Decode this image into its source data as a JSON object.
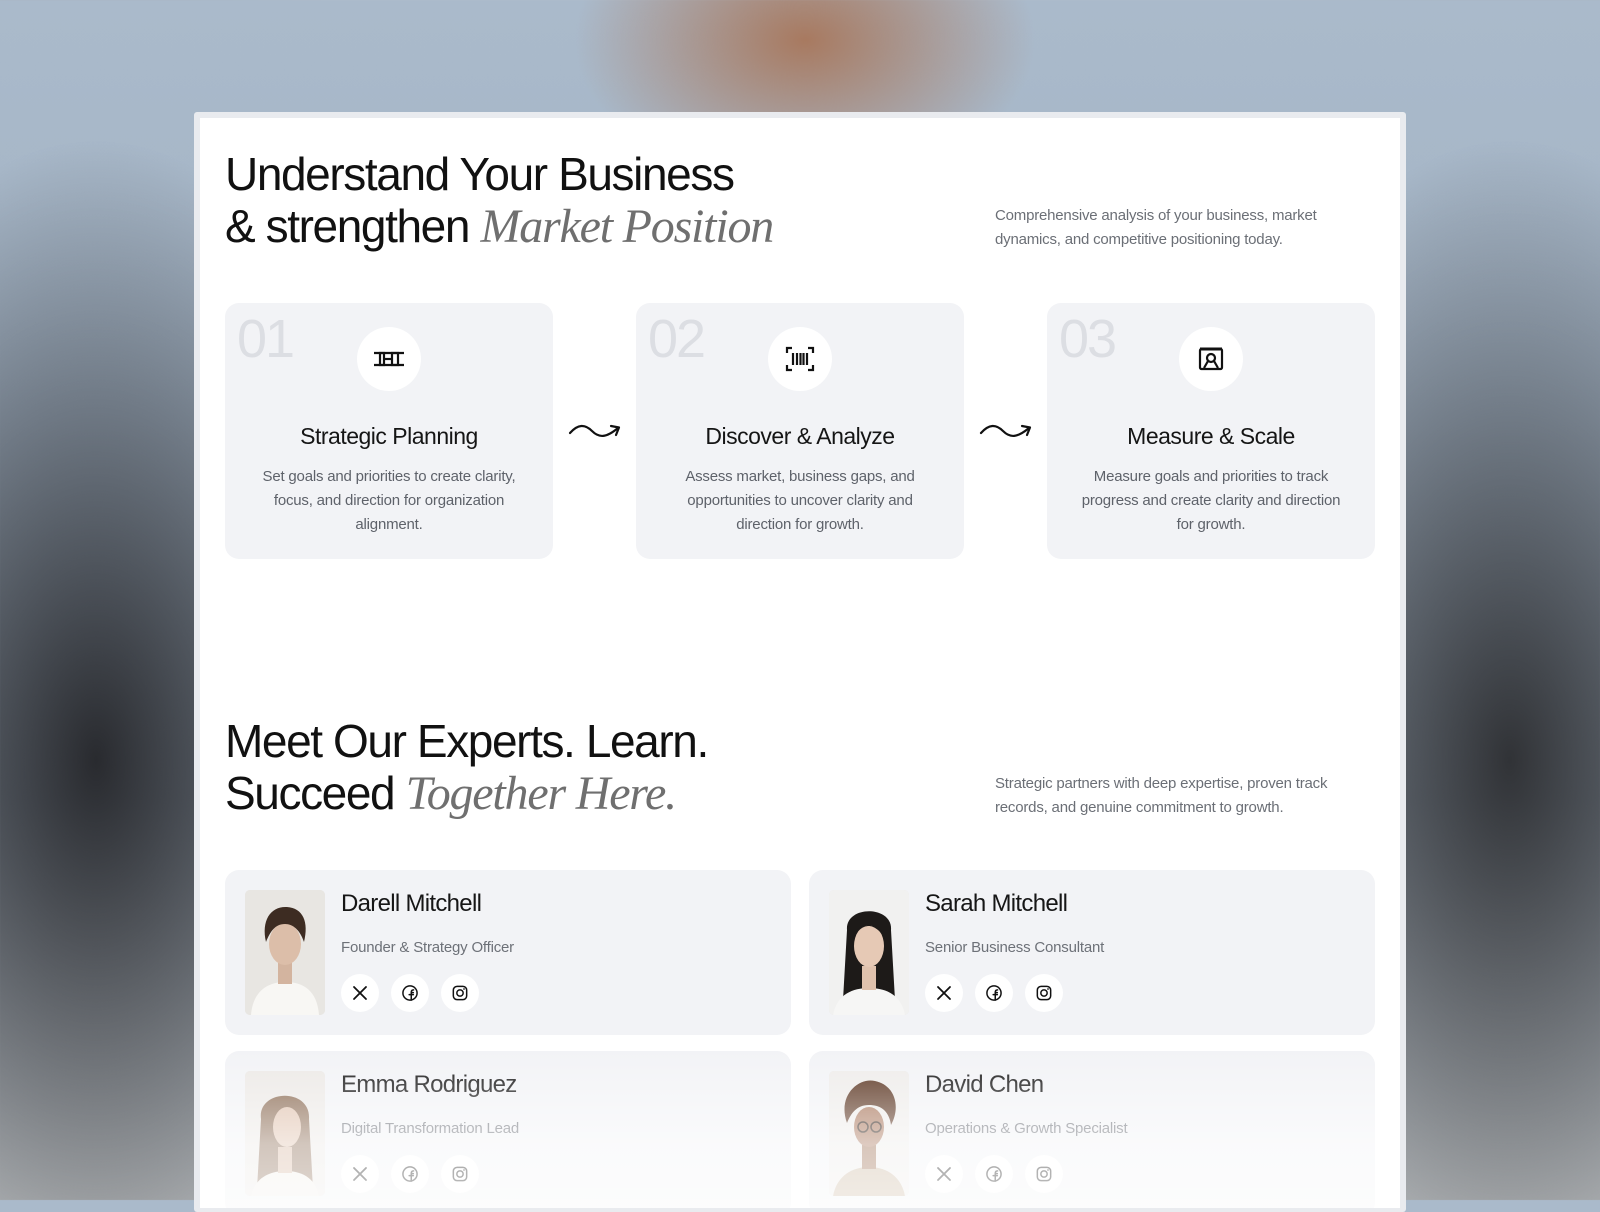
{
  "section1": {
    "title_line1": "Understand Your Business",
    "title_line2": "& strengthen",
    "title_italic": "Market Position",
    "description": "Comprehensive analysis of your business, market dynamics, and competitive positioning today.",
    "steps": [
      {
        "num": "01",
        "icon": "strategy-icon",
        "title": "Strategic Planning",
        "text": "Set goals and priorities to create clarity, focus, and direction for organization alignment."
      },
      {
        "num": "02",
        "icon": "barcode-scan-icon",
        "title": "Discover & Analyze",
        "text": "Assess market, business gaps, and opportunities to uncover clarity and direction for growth."
      },
      {
        "num": "03",
        "icon": "presentation-chart-icon",
        "title": "Measure & Scale",
        "text": "Measure goals and priorities to track progress and create clarity and direction for growth."
      }
    ]
  },
  "section2": {
    "title_line1": "Meet Our Experts. Learn.",
    "title_line2": "Succeed",
    "title_italic": "Together Here.",
    "description": "Strategic partners with deep expertise, proven track records, and genuine commitment to growth.",
    "experts": [
      {
        "name": "Darell Mitchell",
        "role": "Founder & Strategy Officer"
      },
      {
        "name": "Sarah Mitchell",
        "role": "Senior Business Consultant"
      },
      {
        "name": "Emma Rodriguez",
        "role": "Digital Transformation Lead"
      },
      {
        "name": "David Chen",
        "role": "Operations & Growth Specialist"
      }
    ],
    "social_icons": [
      "x-icon",
      "facebook-icon",
      "instagram-icon"
    ]
  },
  "colors": {
    "card_bg": "#f2f3f6",
    "text_primary": "#151515",
    "text_muted": "#6b6f76",
    "italic_accent": "#6f6f6f"
  }
}
